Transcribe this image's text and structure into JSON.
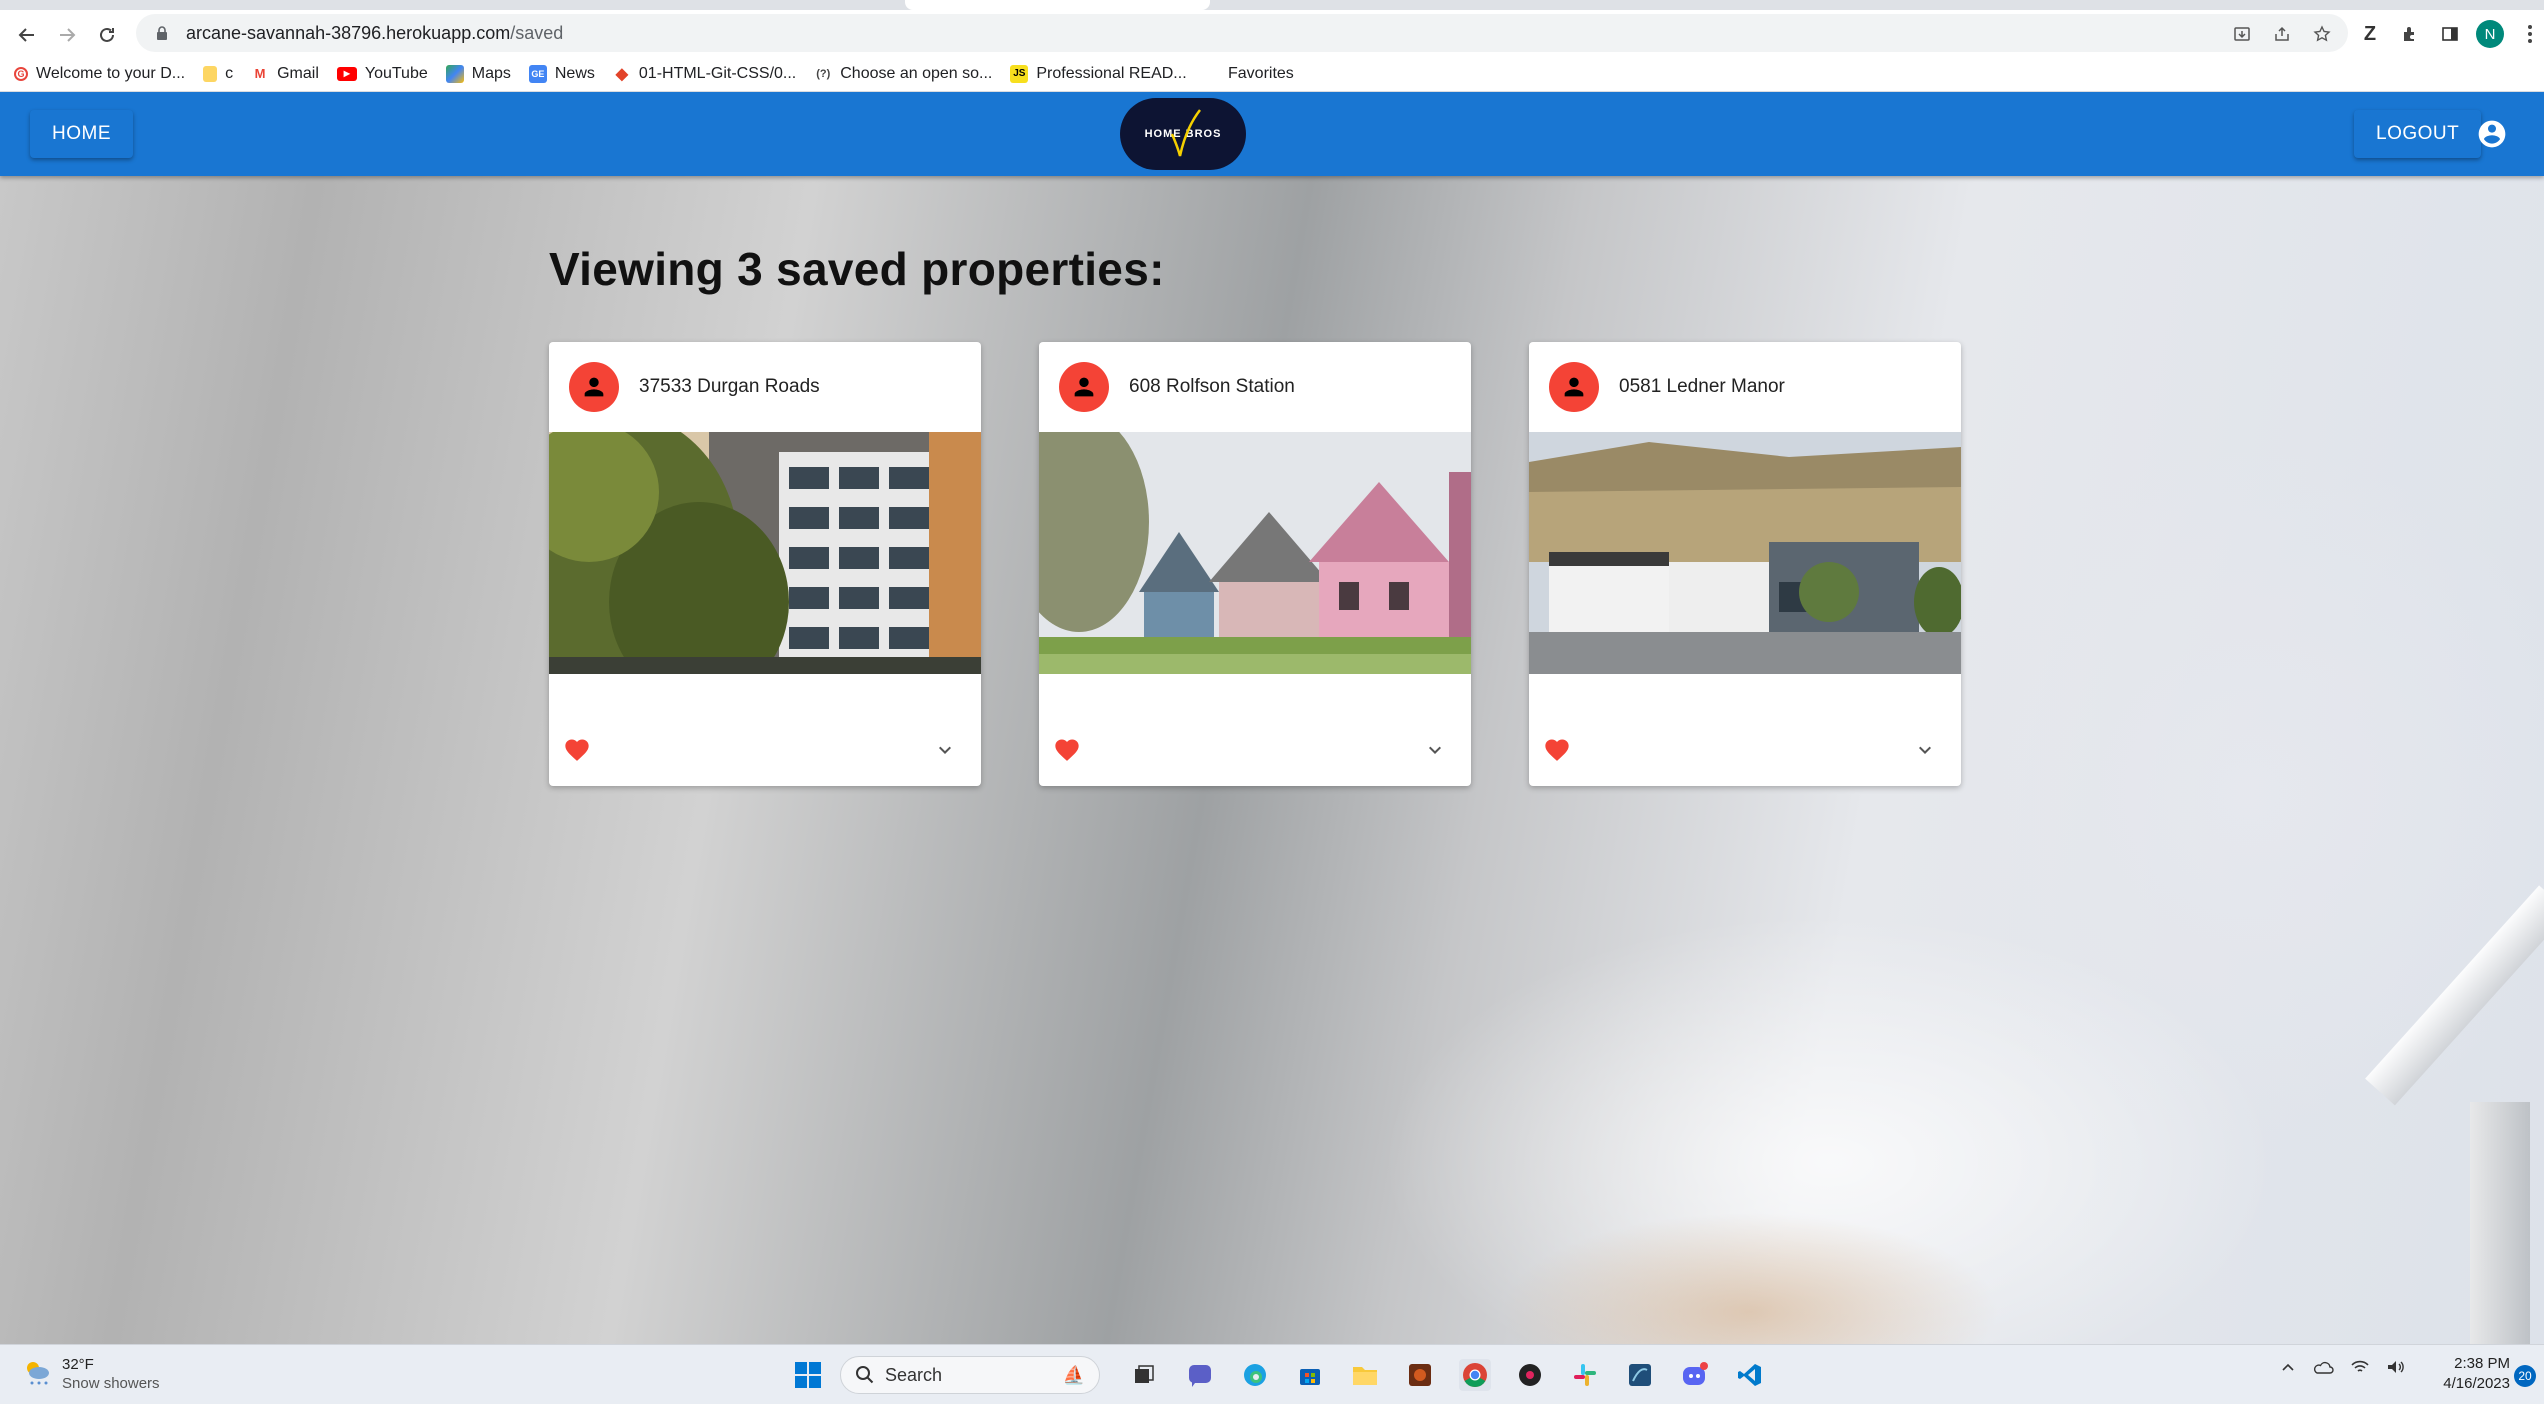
{
  "browser": {
    "url_host": "arcane-savannah-38796.herokuapp.com",
    "url_path": "/saved",
    "profile_initial": "N",
    "bookmarks": [
      {
        "label": "Welcome to your D...",
        "icon": "g-icon"
      },
      {
        "label": "c",
        "icon": "folder-icon"
      },
      {
        "label": "Gmail",
        "icon": "gmail-icon"
      },
      {
        "label": "YouTube",
        "icon": "youtube-icon"
      },
      {
        "label": "Maps",
        "icon": "maps-icon"
      },
      {
        "label": "News",
        "icon": "news-icon"
      },
      {
        "label": "01-HTML-Git-CSS/0...",
        "icon": "gitlab-icon"
      },
      {
        "label": "Choose an open so...",
        "icon": "question-icon"
      },
      {
        "label": "Professional READ...",
        "icon": "js-icon"
      }
    ],
    "favorites_label": "Favorites"
  },
  "appbar": {
    "home_label": "HOME",
    "logout_label": "LOGOUT",
    "logo_text": "HOME BROS",
    "color": "#1976d2"
  },
  "main": {
    "heading": "Viewing 3 saved properties:",
    "cards": [
      {
        "title": "37533 Durgan Roads",
        "image": "apartment-building"
      },
      {
        "title": "608 Rolfson Station",
        "image": "victorian-houses"
      },
      {
        "title": "0581 Ledner Manor",
        "image": "suburban-development"
      }
    ],
    "avatar_color": "#f44336",
    "heart_color": "#f44336"
  },
  "taskbar": {
    "weather_temp": "32°F",
    "weather_condition": "Snow showers",
    "search_label": "Search",
    "time": "2:38 PM",
    "date": "4/16/2023",
    "notification_count": "20"
  }
}
